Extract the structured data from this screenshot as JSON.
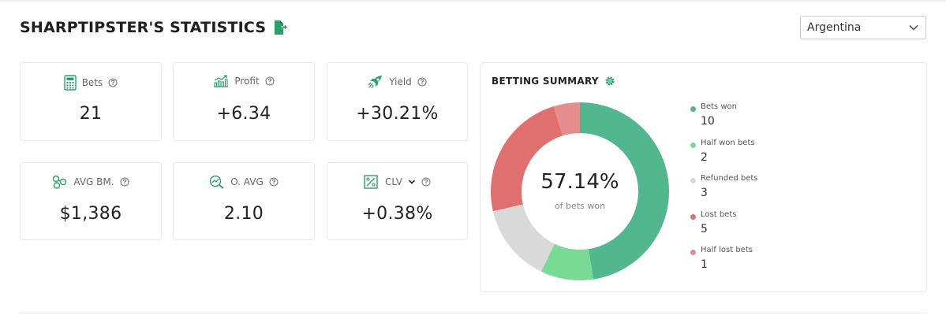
{
  "header": {
    "title": "SHARPTIPSTER'S STATISTICS",
    "export_icon": "file-export-icon",
    "country_selected": "Argentina"
  },
  "stats": [
    {
      "label": "Bets",
      "value": "21",
      "icon": "calculator-icon"
    },
    {
      "label": "Profit",
      "value": "+6.34",
      "icon": "growth-chart-icon"
    },
    {
      "label": "Yield",
      "value": "+30.21%",
      "icon": "rocket-icon"
    },
    {
      "label": "AVG BM.",
      "value": "$1,386",
      "icon": "coins-icon"
    },
    {
      "label": "O. AVG",
      "value": "2.10",
      "icon": "trend-magnifier-icon"
    },
    {
      "label": "CLV",
      "value": "+0.38%",
      "icon": "percent-box-icon"
    }
  ],
  "summary": {
    "title": "BETTING SUMMARY",
    "settings_icon": "gear-icon",
    "center_value": "57.14%",
    "center_label": "of bets won"
  },
  "colors": {
    "accent": "#2e9e6a",
    "bets_won": "#52b68f",
    "half_won": "#78da95",
    "refunded": "#d9d9d9",
    "lost": "#e07070",
    "half_lost": "#e58d8d"
  },
  "chart_data": {
    "type": "pie",
    "variant": "donut",
    "title": "BETTING SUMMARY",
    "categories": [
      "Bets won",
      "Half won bets",
      "Refunded bets",
      "Lost bets",
      "Half lost bets"
    ],
    "values": [
      10,
      2,
      3,
      5,
      1
    ],
    "colors": [
      "#52b68f",
      "#78da95",
      "#d9d9d9",
      "#e07070",
      "#e58d8d"
    ],
    "legend": "right"
  }
}
